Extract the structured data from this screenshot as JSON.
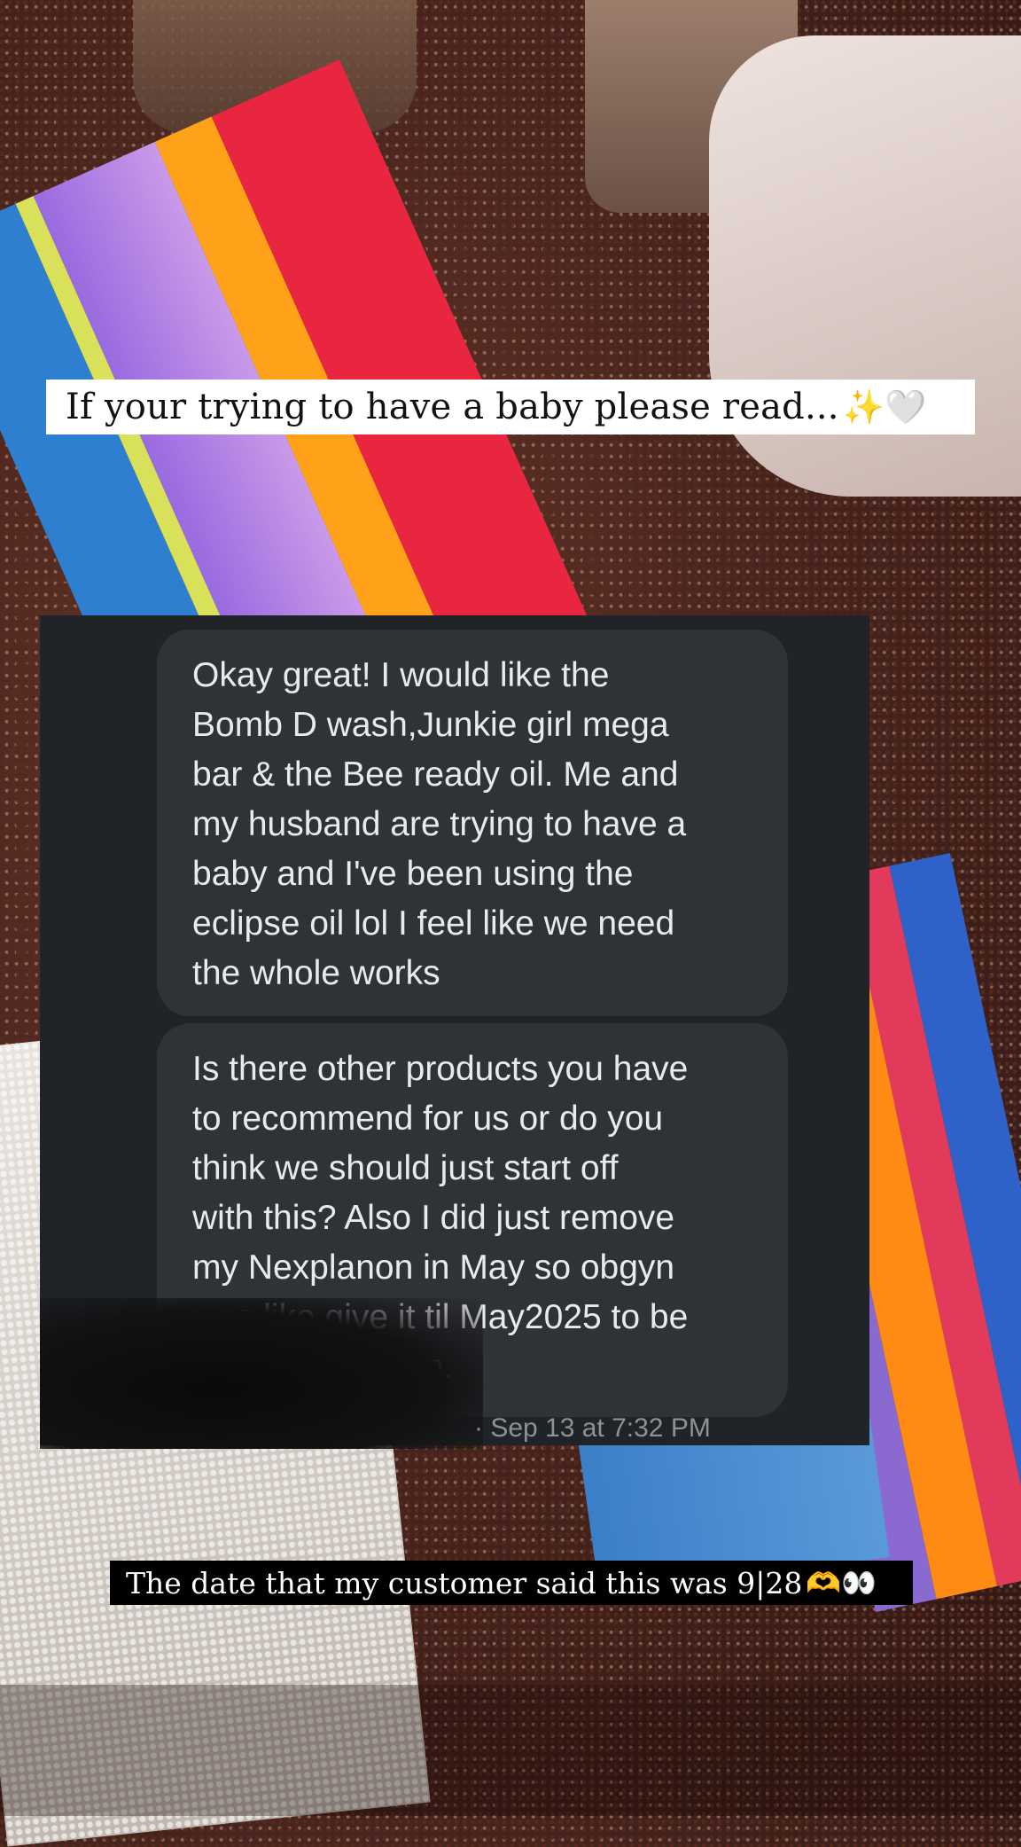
{
  "title_banner": {
    "text": "If your trying to have a baby please read...",
    "emoji": "✨🤍"
  },
  "messages": [
    {
      "text": "Okay great! I would like the\nBomb D wash,Junkie girl mega\nbar & the Bee ready oil. Me and\nmy husband are trying to have a\nbaby and I've been using the\neclipse oil lol I feel like we need\nthe whole works"
    },
    {
      "text": "Is there other products you have\nto recommend for us or do you\nthink we should just start off\nwith this? Also I did just remove\nmy Nexplanon in May so obgyn\nwas like give it til May2025 to be\noutta my system."
    }
  ],
  "timestamp": "· Sep 13 at 7:32 PM",
  "caption_banner": {
    "text": "The date that my customer said this was 9|28",
    "emoji": "🫶👀"
  },
  "colors": {
    "chat_background": "#202327",
    "bubble_background": "#2f3236",
    "bubble_text": "#e9eaec",
    "timestamp_text": "#8e9196"
  }
}
